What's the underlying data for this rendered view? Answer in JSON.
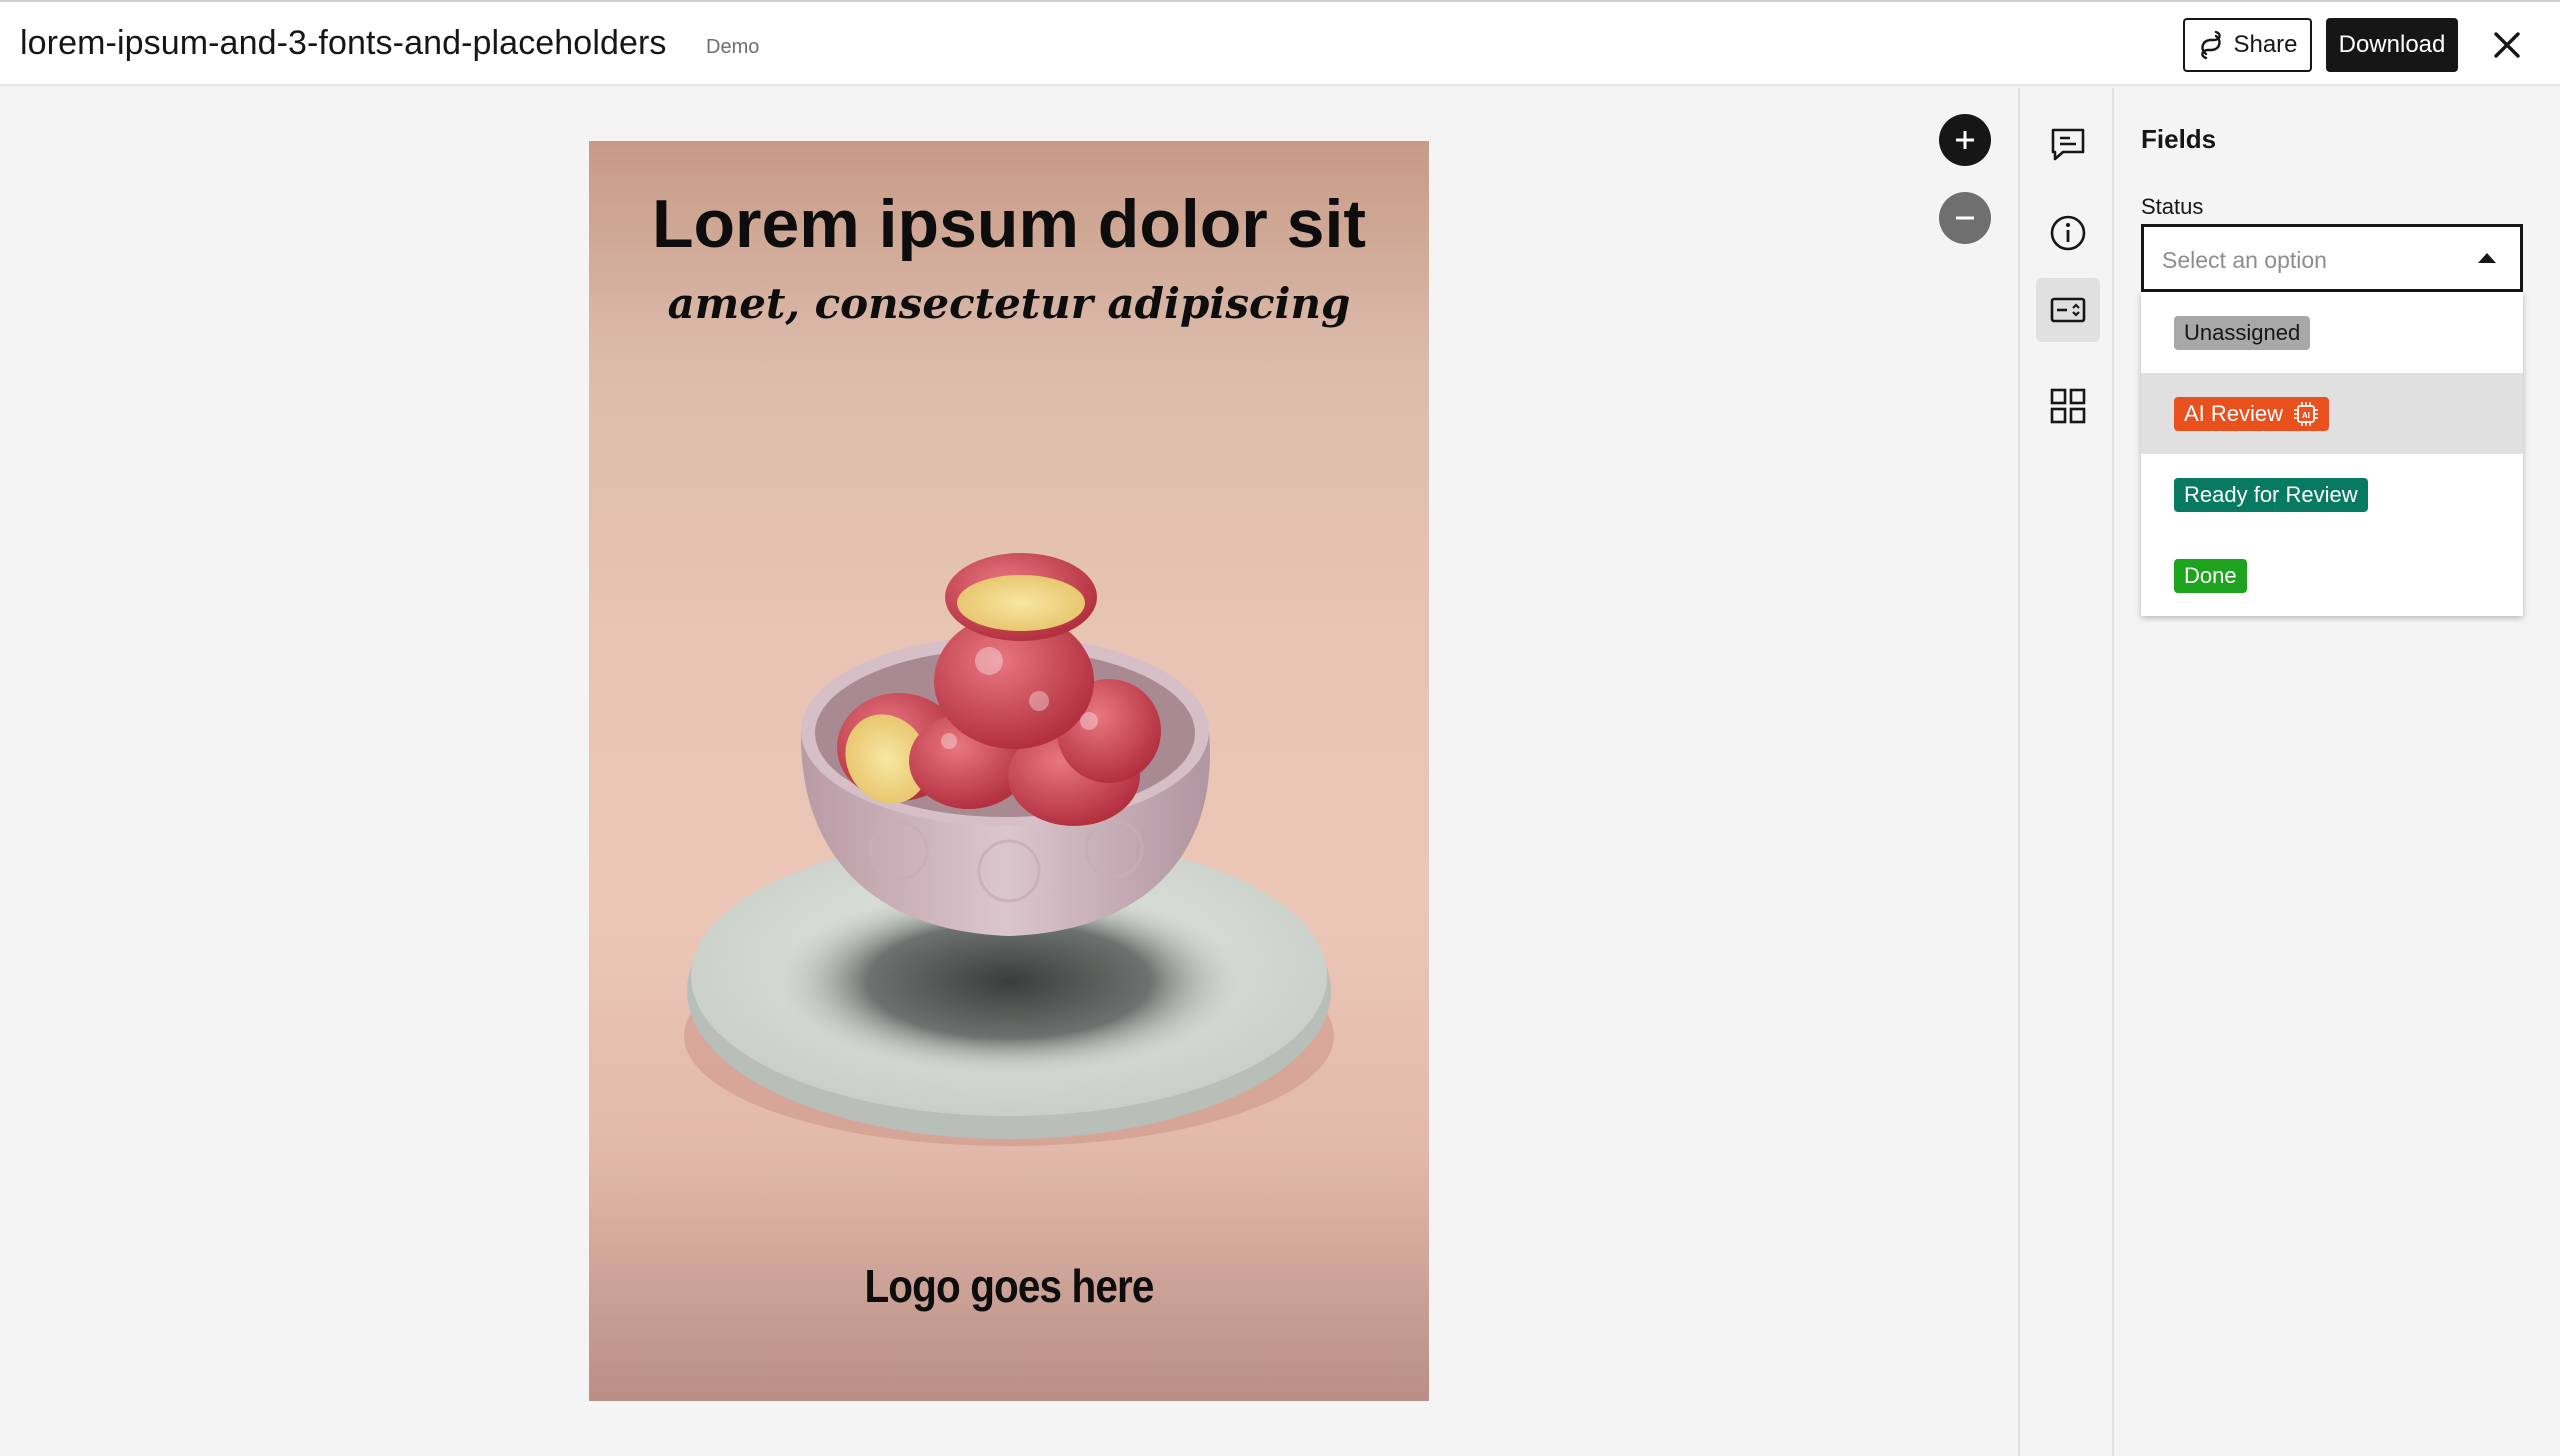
{
  "header": {
    "title": "lorem-ipsum-and-3-fonts-and-placeholders",
    "badge": "Demo",
    "share_label": "Share",
    "download_label": "Download",
    "close_icon": "close-icon"
  },
  "canvas": {
    "poster": {
      "headline": "Lorem ipsum dolor sit",
      "subheadline": "amet, consectetur adipiscing",
      "logo_placeholder": "Logo goes here",
      "image_subject": "bowl of mochi on plate"
    },
    "zoom_in_label": "+",
    "zoom_out_label": "−"
  },
  "rail": {
    "items": [
      {
        "name": "comments",
        "icon": "comment-icon"
      },
      {
        "name": "info",
        "icon": "info-icon"
      },
      {
        "name": "fields",
        "icon": "fields-icon",
        "active": true
      },
      {
        "name": "apps",
        "icon": "grid-icon"
      }
    ]
  },
  "panel": {
    "title": "Fields",
    "status_label": "Status",
    "status_placeholder": "Select an option",
    "options": [
      {
        "label": "Unassigned",
        "color": "#a8a8a8"
      },
      {
        "label": "AI Review",
        "color": "#e8501e",
        "icon": "ai-chip-icon"
      },
      {
        "label": "Ready for Review",
        "color": "#087a62"
      },
      {
        "label": "Done",
        "color": "#1ea31e"
      }
    ]
  }
}
